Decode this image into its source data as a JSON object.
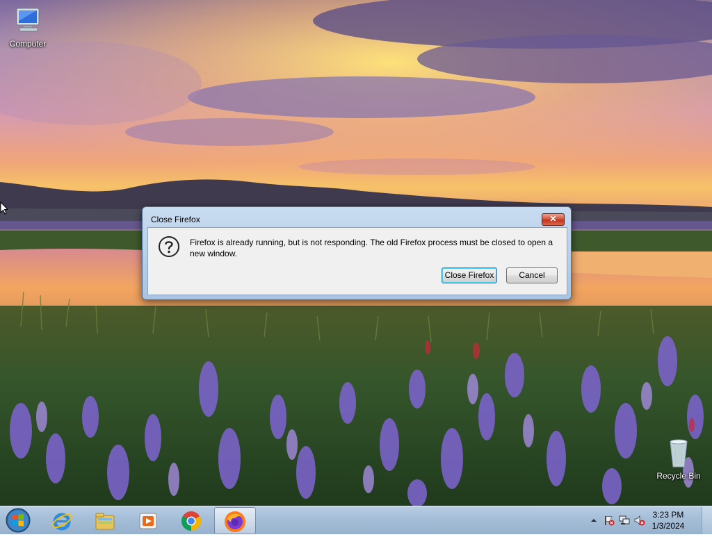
{
  "desktop": {
    "icons": [
      {
        "label": "Computer",
        "icon": "computer-icon"
      },
      {
        "label": "Recycle Bin",
        "icon": "recycle-bin-icon"
      }
    ]
  },
  "dialog": {
    "title": "Close Firefox",
    "close_glyph": "✕",
    "icon": "question-icon",
    "message": "Firefox is already running, but is not responding. The old Firefox process must be closed to open a new window.",
    "buttons": {
      "primary": "Close Firefox",
      "secondary": "Cancel"
    }
  },
  "taskbar": {
    "start": "windows-start-icon",
    "pinned": [
      {
        "name": "internet-explorer-icon"
      },
      {
        "name": "file-explorer-icon"
      },
      {
        "name": "media-player-icon"
      },
      {
        "name": "chrome-icon"
      },
      {
        "name": "firefox-icon",
        "active": true
      }
    ],
    "tray": {
      "icons": [
        "show-hidden-icons-chevron",
        "action-center-flag-icon",
        "network-icon",
        "volume-muted-icon"
      ],
      "time": "3:23 PM",
      "date": "1/3/2024"
    }
  },
  "colors": {
    "taskbar": "#a5bed8",
    "dialog_frame": "#a9c4e2",
    "dialog_body": "#f0f0f0",
    "close_red": "#c3331b"
  }
}
